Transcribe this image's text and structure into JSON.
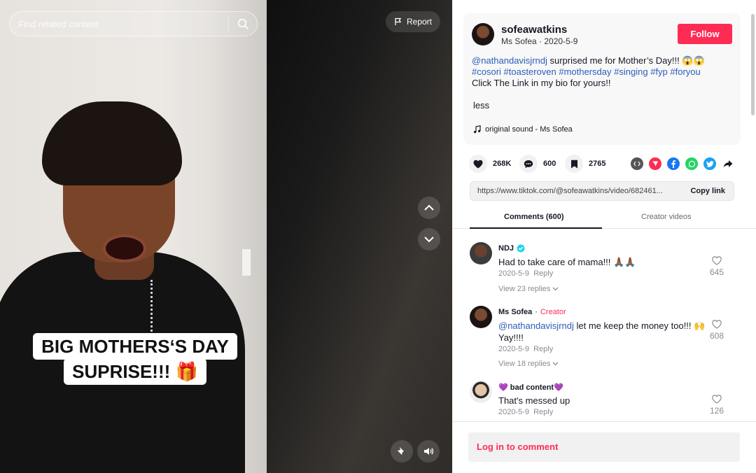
{
  "search": {
    "placeholder": "Find related content"
  },
  "video": {
    "report_label": "Report",
    "caption_lines": [
      "BIG MOTHERS‘S DAY",
      "SUPRISE!!! 🎁"
    ]
  },
  "post": {
    "username": "sofeawatkins",
    "display_name": "Ms Sofea",
    "date": "2020-5-9",
    "follow_label": "Follow",
    "mention": "@nathandavisjrndj",
    "desc_text": " surprised me for Mother’s Day!!! 😱😱",
    "hashtags": [
      "#cosori",
      "#toasteroven",
      "#mothersday",
      "#singing",
      "#fyp",
      "#foryou"
    ],
    "desc_line3": "Click The Link in my bio for yours!!",
    "less_label": "less",
    "music": "original sound - Ms Sofea"
  },
  "stats": {
    "likes": "268K",
    "comments": "600",
    "saves": "2765"
  },
  "share_icons": [
    {
      "name": "embed-icon",
      "color": "#555555"
    },
    {
      "name": "send-to-friends-icon",
      "color": "#fe2c55"
    },
    {
      "name": "facebook-icon",
      "color": "#1877f2"
    },
    {
      "name": "whatsapp-icon",
      "color": "#25d366"
    },
    {
      "name": "twitter-icon",
      "color": "#1da1f2"
    },
    {
      "name": "share-arrow-icon",
      "color": "#161823"
    }
  ],
  "link": {
    "url": "https://www.tiktok.com/@sofeawatkins/video/682461...",
    "copy_label": "Copy link"
  },
  "tabs": {
    "comments": "Comments (600)",
    "creator": "Creator videos"
  },
  "comments": [
    {
      "name": "NDJ",
      "verified": true,
      "creator": false,
      "mention": "",
      "text": "Had to take care of mama!!! 🙏🏾🙏🏾",
      "date": "2020-5-9",
      "reply": "Reply",
      "likes": "645",
      "replies": "View 23 replies"
    },
    {
      "name": "Ms Sofea",
      "verified": false,
      "creator_label": "Creator",
      "mention": "@nathandavisjrndj",
      "text": " let me keep the money too!!! 🙌 Yay!!!!",
      "date": "2020-5-9",
      "reply": "Reply",
      "likes": "608",
      "replies": "View 18 replies"
    },
    {
      "name": "💜 bad content💜",
      "verified": false,
      "creator": false,
      "mention": "",
      "text": "That's messed up",
      "date": "2020-5-9",
      "reply": "Reply",
      "likes": "126",
      "replies": ""
    }
  ],
  "login": {
    "label": "Log in to comment"
  },
  "colors": {
    "brand": "#fe2c55",
    "link": "#2b5db9",
    "verified": "#20d5ec"
  }
}
